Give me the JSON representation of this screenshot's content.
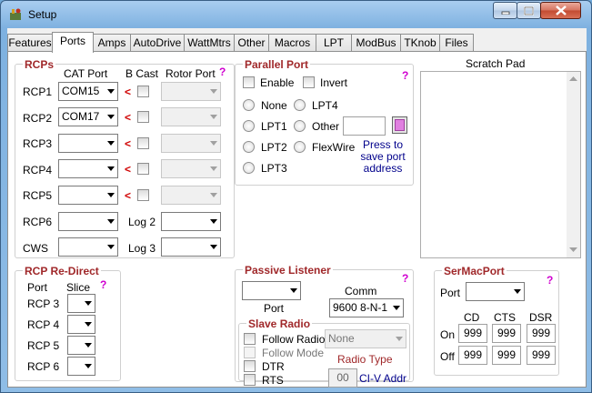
{
  "window": {
    "title": "Setup"
  },
  "tabs": [
    "Features",
    "Ports",
    "Amps",
    "AutoDrive",
    "WattMtrs",
    "Other",
    "Macros",
    "LPT",
    "ModBus",
    "TKnob",
    "Files"
  ],
  "rcps": {
    "title": "RCPs",
    "help": "?",
    "col_cat": "CAT Port",
    "col_bcast": "B Cast",
    "col_rotor": "Rotor Port",
    "rows": [
      {
        "label": "RCP1",
        "port": "COM15"
      },
      {
        "label": "RCP2",
        "port": "COM17"
      },
      {
        "label": "RCP3",
        "port": ""
      },
      {
        "label": "RCP4",
        "port": ""
      },
      {
        "label": "RCP5",
        "port": ""
      },
      {
        "label": "RCP6",
        "port": "",
        "log": "Log 2"
      },
      {
        "label": "CWS",
        "port": "",
        "log": "Log 3"
      }
    ],
    "arrow": "<"
  },
  "redirect": {
    "title": "RCP Re-Direct",
    "help": "?",
    "col_port": "Port",
    "col_slice": "Slice",
    "rows": [
      "RCP 3",
      "RCP 4",
      "RCP 5",
      "RCP 6"
    ]
  },
  "parallel": {
    "title": "Parallel Port",
    "help": "?",
    "enable": "Enable",
    "invert": "Invert",
    "opt_none": "None",
    "opt_lpt1": "LPT1",
    "opt_lpt2": "LPT2",
    "opt_lpt3": "LPT3",
    "opt_lpt4": "LPT4",
    "opt_other": "Other",
    "opt_flexwire": "FlexWire",
    "other_value": "",
    "press_note": "Press to save port address"
  },
  "scratch": {
    "title": "Scratch Pad",
    "content": ""
  },
  "passive": {
    "title": "Passive Listener",
    "help": "?",
    "port_label": "Port",
    "port_value": "",
    "comm_label": "Comm",
    "comm_value": "9600 8-N-1"
  },
  "slave": {
    "title": "Slave Radio",
    "follow_radio": "Follow Radio",
    "follow_mode": "Follow Mode",
    "dtr": "DTR",
    "rts": "RTS",
    "radio_type_value": "None",
    "radio_type_label": "Radio Type",
    "civ_value": "00",
    "civ_label": "CI-V Addr"
  },
  "sermac": {
    "title": "SerMacPort",
    "help": "?",
    "port_label": "Port",
    "port_value": "",
    "col_cd": "CD",
    "col_cts": "CTS",
    "col_dsr": "DSR",
    "on_label": "On",
    "off_label": "Off",
    "on_values": [
      "999",
      "999",
      "999"
    ],
    "off_values": [
      "999",
      "999",
      "999"
    ]
  },
  "colors": {
    "group_title": "#a0282a",
    "help": "#d000d0",
    "button_accent": "#e080e0"
  }
}
